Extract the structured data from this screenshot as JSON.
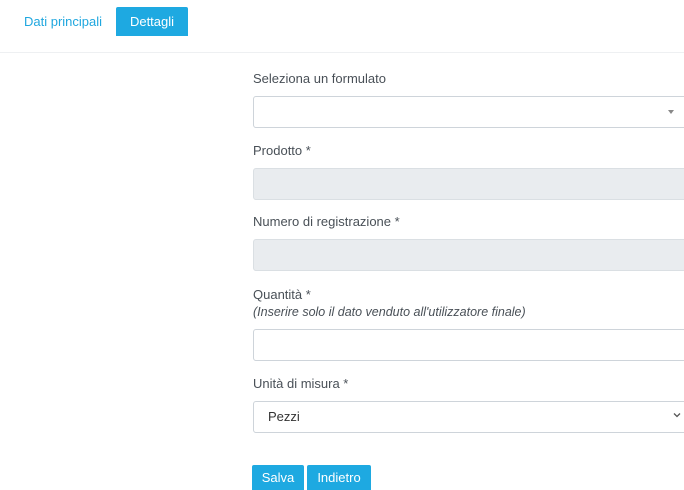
{
  "tabs": [
    {
      "label": "Dati principali",
      "active": false
    },
    {
      "label": "Dettagli",
      "active": true
    }
  ],
  "form": {
    "formulato": {
      "label": "Seleziona un formulato",
      "value": ""
    },
    "prodotto": {
      "label": "Prodotto *",
      "value": ""
    },
    "registrazione": {
      "label": "Numero di registrazione *",
      "value": ""
    },
    "quantita": {
      "label": "Quantità *",
      "hint": "(Inserire solo il dato venduto all'utilizzatore finale)",
      "value": ""
    },
    "unita": {
      "label": "Unità di misura *",
      "value": "Pezzi"
    }
  },
  "buttons": {
    "save_label": "Salva",
    "back_label": "Indietro"
  },
  "colors": {
    "accent": "#1ea9e1",
    "disabled_bg": "#e9ecef",
    "border": "#ced4da"
  }
}
